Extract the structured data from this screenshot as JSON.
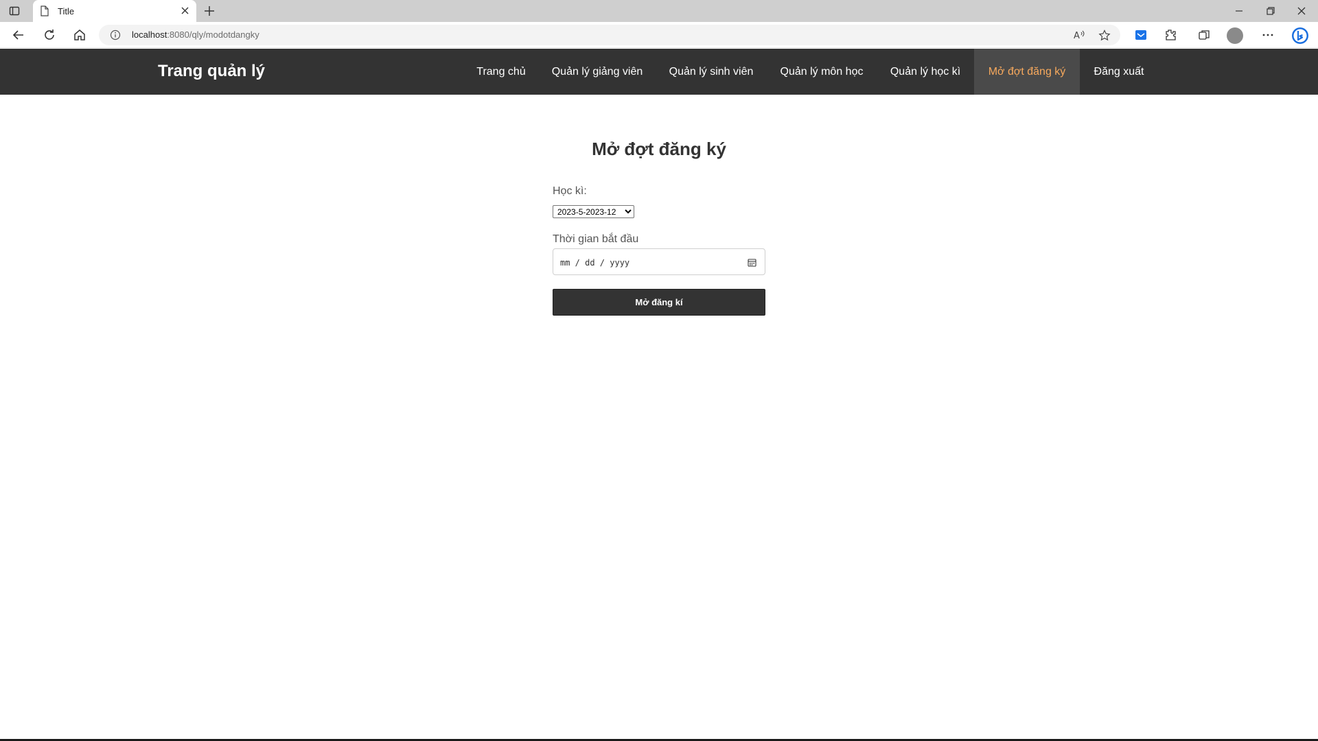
{
  "browser": {
    "tab_title": "Title",
    "url_host": "localhost",
    "url_rest": ":8080/qly/modotdangky"
  },
  "navbar": {
    "brand": "Trang quản lý",
    "items": [
      {
        "label": "Trang chủ"
      },
      {
        "label": "Quản lý giảng viên"
      },
      {
        "label": "Quản lý sinh viên"
      },
      {
        "label": "Quản lý môn học"
      },
      {
        "label": "Quản lý học kì"
      },
      {
        "label": "Mở đợt đăng ký"
      },
      {
        "label": "Đăng xuất"
      }
    ],
    "active_color": "#f7a95d",
    "background": "#333333"
  },
  "form": {
    "title": "Mở đợt đăng ký",
    "semester_label": "Học kì:",
    "semester_value": "2023-5-2023-12",
    "start_label": "Thời gian bắt đầu",
    "date_placeholder": "mm / dd / yyyy",
    "submit_label": "Mở đăng kí"
  }
}
